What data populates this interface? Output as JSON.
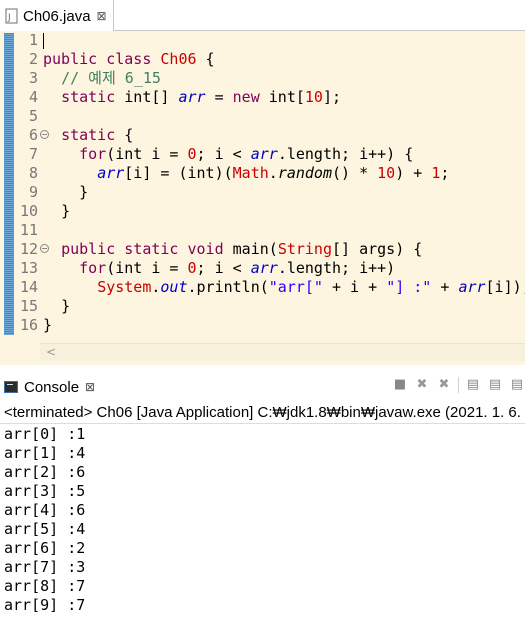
{
  "editor_tab": {
    "label": "Ch06.java",
    "close": "⊠"
  },
  "line_numbers": [
    "1",
    "2",
    "3",
    "4",
    "5",
    "6",
    "7",
    "8",
    "9",
    "10",
    "11",
    "12",
    "13",
    "14",
    "15",
    "16"
  ],
  "code": {
    "l2": {
      "kw1": "public",
      "kw2": "class",
      "cls": "Ch06",
      "rest": " {"
    },
    "l3": {
      "comment": "// 예제 6_15"
    },
    "l4": {
      "kw1": "static",
      "type": " int[] ",
      "fld": "arr",
      "eq": " = ",
      "kw2": "new",
      "type2": " int[",
      "num": "10",
      "end": "];"
    },
    "l6": {
      "kw": "static",
      "rest": " {"
    },
    "l7": {
      "kw": "for",
      "a": "(int i = ",
      "n0": "0",
      "b": "; i < ",
      "fld": "arr",
      "c": ".length; i++) {"
    },
    "l8": {
      "fld": "arr",
      "a": "[i] = (int)(",
      "cls": "Math",
      "dot": ".",
      "method": "random",
      "b": "() * ",
      "n10": "10",
      "c": ") + ",
      "n1": "1",
      "end": ";"
    },
    "l9": {
      "text": "}"
    },
    "l10": {
      "text": "}"
    },
    "l12": {
      "kw1": "public",
      "kw2": "static",
      "kw3": "void",
      "a": " main(",
      "cls": "String",
      "b": "[] args) {"
    },
    "l13": {
      "kw": "for",
      "a": "(int i = ",
      "n0": "0",
      "b": "; i < ",
      "fld": "arr",
      "c": ".length; i++)"
    },
    "l14": {
      "cls": "System",
      "dot": ".",
      "out": "out",
      "a": ".println(",
      "s1": "\"arr[\"",
      "b": " + i + ",
      "s2": "\"] :\"",
      "c": " + ",
      "fld": "arr",
      "end": "[i]);"
    },
    "l15": {
      "text": "}"
    },
    "l16": {
      "text": "}"
    }
  },
  "scroll_left_glyph": "<",
  "console": {
    "tab_label": "Console",
    "close": "⊠",
    "tools": [
      "■",
      "✖",
      "✖",
      "▤",
      "▤",
      "▤"
    ],
    "status": "<terminated> Ch06 [Java Application] C:₩jdk1.8₩bin₩javaw.exe (2021. 1. 6.",
    "output": [
      "arr[0] :1",
      "arr[1] :4",
      "arr[2] :6",
      "arr[3] :5",
      "arr[4] :6",
      "arr[5] :4",
      "arr[6] :2",
      "arr[7] :3",
      "arr[8] :7",
      "arr[9] :7"
    ]
  },
  "colors": {
    "editor_bg": "#fdf5e0",
    "keyword": "#7f0055",
    "number": "#c80000",
    "comment": "#3f7f5f",
    "field": "#0000c0",
    "string": "#2a00ff"
  }
}
